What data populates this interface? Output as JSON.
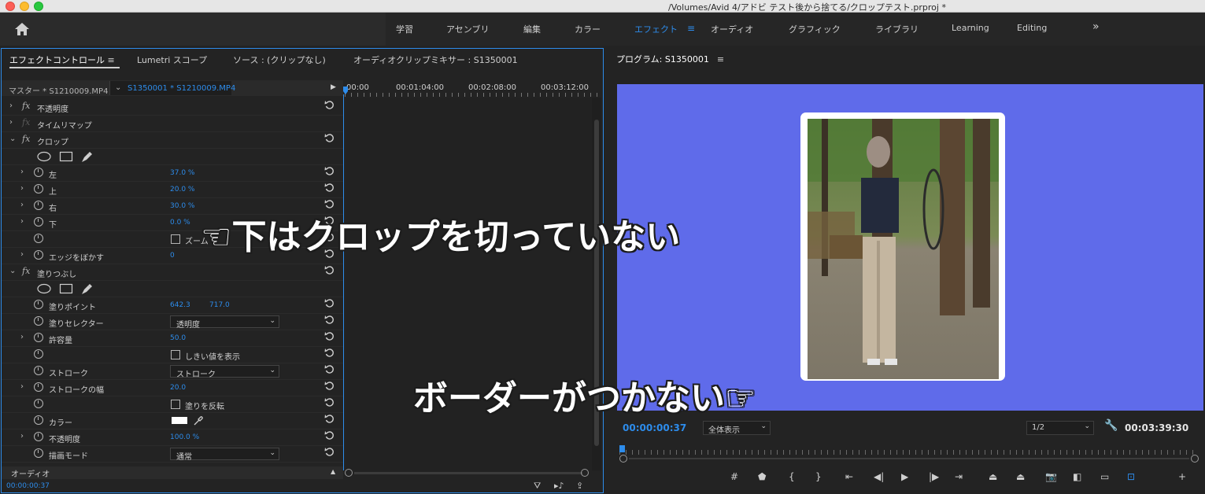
{
  "window": {
    "title": "/Volumes/Avid 4/アドビ テスト後から捨てる/クロップテスト.prproj *"
  },
  "workspaces": {
    "items": [
      "学習",
      "アセンブリ",
      "編集",
      "カラー",
      "エフェクト",
      "オーディオ",
      "グラフィック",
      "ライブラリ",
      "Learning",
      "Editing"
    ],
    "active": "エフェクト",
    "menu_glyph": "≡",
    "more_glyph": "»"
  },
  "left_panel": {
    "tabs": [
      {
        "label": "エフェクトコントロール",
        "active": true
      },
      {
        "label": "Lumetri スコープ",
        "active": false
      },
      {
        "label": "ソース : (クリップなし)",
        "active": false
      },
      {
        "label": "オーディオクリップミキサー : S1350001",
        "active": false
      }
    ],
    "tab_menu_glyph": "≡",
    "master_label": "マスター * S1210009.MP4",
    "clip_selector": "S1350001 * S1210009.MP4",
    "timecodes": [
      "00:00",
      "00:01:04:00",
      "00:02:08:00",
      "00:03:12:00"
    ],
    "rows": [
      {
        "type": "effect",
        "expand": "›",
        "fx": "fx",
        "label": "不透明度",
        "reset": true
      },
      {
        "type": "effect",
        "expand": "›",
        "fx": "fx",
        "fx_dim": true,
        "label": "タイムリマップ",
        "reset": false
      },
      {
        "type": "effect",
        "expand": "⌄",
        "fx": "fx",
        "label": "クロップ",
        "reset": true
      },
      {
        "type": "mask",
        "indent": 44
      },
      {
        "type": "prop",
        "expand": "›",
        "label": "左",
        "value": "37.0 %",
        "reset": true
      },
      {
        "type": "prop",
        "expand": "›",
        "label": "上",
        "value": "20.0 %",
        "reset": true
      },
      {
        "type": "prop",
        "expand": "›",
        "label": "右",
        "value": "30.0 %",
        "reset": true
      },
      {
        "type": "prop",
        "expand": "›",
        "label": "下",
        "value": "0.0 %",
        "reset": true
      },
      {
        "type": "checkbox",
        "label": "ズーム",
        "reset": true
      },
      {
        "type": "prop",
        "expand": "›",
        "label": "エッジをぼかす",
        "value": "0",
        "reset": true
      },
      {
        "type": "effect",
        "expand": "⌄",
        "fx": "fx",
        "label": "塗りつぶし",
        "reset": true
      },
      {
        "type": "mask",
        "indent": 44
      },
      {
        "type": "prop",
        "expand": "",
        "label": "塗りポイント",
        "value": "642.3",
        "value2": "717.0",
        "reset": true
      },
      {
        "type": "dropdown",
        "expand": "",
        "label": "塗りセレクター",
        "value": "透明度",
        "reset": true
      },
      {
        "type": "prop",
        "expand": "›",
        "label": "許容量",
        "value": "50.0",
        "reset": true
      },
      {
        "type": "checkbox",
        "label": "しきい値を表示",
        "reset": true
      },
      {
        "type": "dropdown",
        "expand": "",
        "label": "ストローク",
        "value": "ストローク",
        "reset": true
      },
      {
        "type": "prop",
        "expand": "›",
        "label": "ストロークの幅",
        "value": "20.0",
        "reset": true
      },
      {
        "type": "checkbox",
        "label": "塗りを反転",
        "reset": true
      },
      {
        "type": "color",
        "expand": "",
        "label": "カラー",
        "reset": true
      },
      {
        "type": "prop",
        "expand": "›",
        "label": "不透明度",
        "value": "100.0 %",
        "reset": true
      },
      {
        "type": "dropdown",
        "expand": "",
        "label": "描画モード",
        "value": "通常",
        "reset": true
      }
    ],
    "audio_label": "オーディオ",
    "current_timecode": "00:00:00:37"
  },
  "program_monitor": {
    "title": "プログラム: S1350001",
    "menu_glyph": "≡",
    "current_timecode": "00:00:00:37",
    "fit": "全体表示",
    "resolution": "1/2",
    "duration": "00:03:39:30",
    "background_color": "#5f6bea"
  },
  "annotations": {
    "crop_note": "☜下はクロップを切っていない",
    "border_note": "ボーダーがつかない☞"
  },
  "colors": {
    "accent": "#2d8ceb",
    "panel_bg": "#232323"
  }
}
